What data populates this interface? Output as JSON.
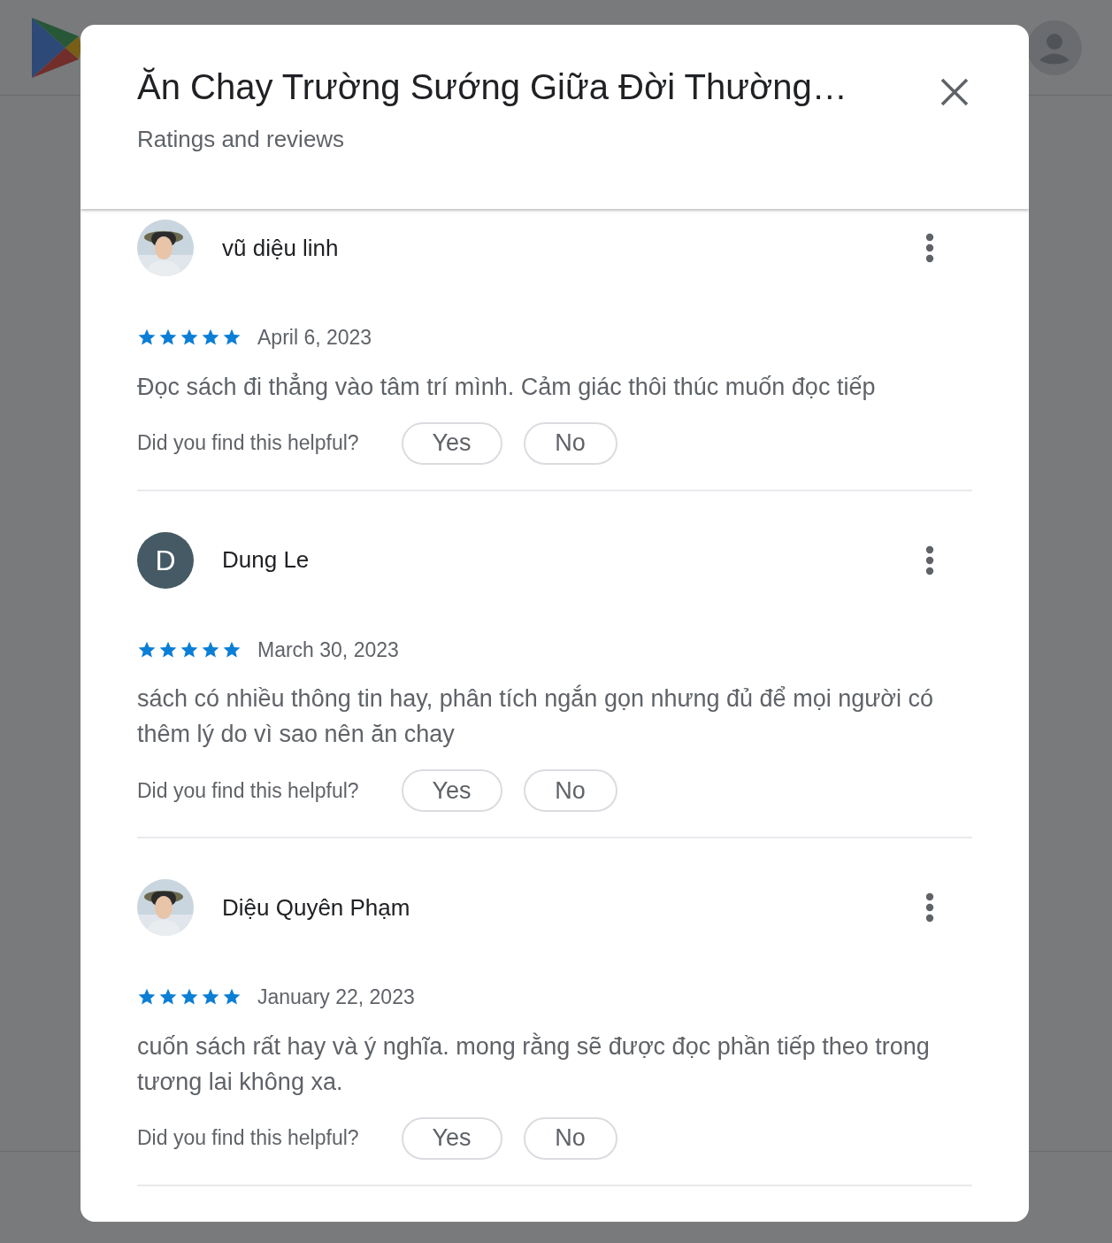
{
  "dialog": {
    "title": "Ăn Chay Trường Sướng Giữa Đời Thường…",
    "subtitle": "Ratings and reviews"
  },
  "reviews": [
    {
      "author": "vũ diệu linh",
      "avatar": {
        "kind": "picture"
      },
      "stars": 5,
      "date": "April 6, 2023",
      "text": "Đọc sách đi thẳng vào tâm trí mình. Cảm giác thôi thúc muốn đọc tiếp",
      "helpful_prompt": "Did you find this helpful?",
      "buttons": [
        "Yes",
        "No"
      ]
    },
    {
      "author": "Dung Le",
      "avatar": {
        "kind": "letter",
        "letter": "D"
      },
      "stars": 5,
      "date": "March 30, 2023",
      "text": "sách có nhiều thông tin hay, phân tích ngắn gọn nhưng đủ để mọi người có thêm lý do vì sao nên ăn chay",
      "helpful_prompt": "Did you find this helpful?",
      "buttons": [
        "Yes",
        "No"
      ]
    },
    {
      "author": "Diệu Quyên Phạm",
      "avatar": {
        "kind": "picture"
      },
      "stars": 5,
      "date": "January 22, 2023",
      "text": "cuốn sách rất hay và ý nghĩa. mong rằng sẽ được đọc phần tiếp theo trong tương lai không xa.",
      "helpful_prompt": "Did you find this helpful?",
      "buttons": [
        "Yes",
        "No"
      ]
    }
  ]
}
